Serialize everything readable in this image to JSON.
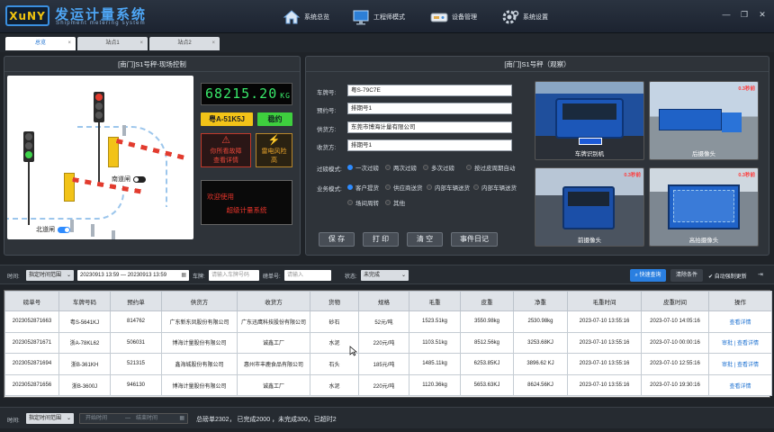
{
  "header": {
    "logo_text": "XuNY",
    "title": "发运计量系统",
    "subtitle": "Shipment metering system",
    "nav": [
      {
        "label": "系统总览",
        "icon": "home-icon"
      },
      {
        "label": "工程师模式",
        "icon": "monitor-icon"
      },
      {
        "label": "设备管理",
        "icon": "device-icon"
      },
      {
        "label": "系统设置",
        "icon": "gear-icon"
      }
    ],
    "window": {
      "minimize": "—",
      "restore": "❐",
      "close": "✕"
    }
  },
  "tabs": [
    {
      "label": "总览",
      "active": true
    },
    {
      "label": "站点1",
      "active": false
    },
    {
      "label": "站点2",
      "active": false
    }
  ],
  "left_panel": {
    "title": "[南门]S1号秤-现场控制",
    "south_gate": "南道闸",
    "north_gate": "北道闸",
    "weight": "68215.20",
    "unit": "KG",
    "plate": "粤A-51K5J",
    "status": "稳约",
    "alarm1": [
      "你所看故障",
      "查看详情"
    ],
    "alarm2": [
      "雷电风险",
      "高"
    ],
    "welcome": [
      "欢迎使用",
      "超级计量系统"
    ]
  },
  "right_panel": {
    "title": "[南门]S1号秤（观察）",
    "fields": [
      {
        "label": "车牌号:",
        "value": "粤S-79C7E"
      },
      {
        "label": "预约号:",
        "value": "排期号1"
      },
      {
        "label": "供货方:",
        "value": "东莞市博海计量有限公司"
      },
      {
        "label": "收货方:",
        "value": "排期号1"
      }
    ],
    "mode_label": "过磅模式:",
    "modes": [
      {
        "label": "一次过磅",
        "on": true
      },
      {
        "label": "两次过磅",
        "on": false
      },
      {
        "label": "多次过磅",
        "on": false
      },
      {
        "label": "按过皮周期自动",
        "on": false
      }
    ],
    "biz_label": "业务模式:",
    "biz": [
      {
        "label": "客户提货",
        "on": true
      },
      {
        "label": "供应商送货",
        "on": false
      },
      {
        "label": "内部车辆送货",
        "on": false
      },
      {
        "label": "内部车辆送货",
        "on": false
      },
      {
        "label": "场间周转",
        "on": false
      },
      {
        "label": "其他",
        "on": false
      }
    ],
    "buttons": [
      "保 存",
      "打 印",
      "清 空",
      "事件日记"
    ],
    "cameras": [
      {
        "caption": "车牌识别机",
        "tag": "",
        "bg": "#2a4f8f"
      },
      {
        "caption": "后摄像头",
        "tag": "0.3秒前",
        "bg": "#7fa3c7"
      },
      {
        "caption": "前摄像头",
        "tag": "0.3秒前",
        "bg": "#5b6a80"
      },
      {
        "caption": "高拍摄像头",
        "tag": "0.3秒前",
        "bg": "#6c7b8a"
      }
    ]
  },
  "filter": {
    "time_label": "时间:",
    "time_range": "指定时间范围",
    "time_value": "20230913  13:59 — 20230913  13:59",
    "plate_label": "车牌:",
    "plate_placeholder": "请输入车牌号码",
    "weigh_label": "磅单号:",
    "weigh_placeholder": "请输入",
    "state_label": "状态:",
    "state_value": "未完成",
    "quick": "快速查询",
    "clear": "清除条件",
    "auto": "自动强制更新"
  },
  "table": {
    "headers": [
      "磅单号",
      "车牌号码",
      "预约单",
      "供货方",
      "收货方",
      "货物",
      "规格",
      "毛重",
      "皮重",
      "净重",
      "毛重时间",
      "皮重时间",
      "操作"
    ],
    "rows": [
      [
        "2023052871663",
        "粤S-5641KJ",
        "814762",
        "广东新东凤股份有限公司",
        "广东迅鹰科技股份有限公司",
        "砂石",
        "52元/吨",
        "1523.51kg",
        "3550.98kg",
        "2530.98kg",
        "2023-07-10  13:55:16",
        "2023-07-10  14:05:16",
        "查看详情"
      ],
      [
        "2023052871671",
        "浙A-78KL62",
        "506031",
        "博海计量股份有限公司",
        "诚鑫工厂",
        "水泥",
        "220元/吨",
        "1103.51kg",
        "8512.56kg",
        "3253.68KJ",
        "2023-07-10  13:55:16",
        "2023-07-10  00:00:16",
        "审批 | 查看详情"
      ],
      [
        "2023052871694",
        "浙B-361KH",
        "521315",
        "鑫海城股份有限公司",
        "惠州市丰鹿食品有限公司",
        "石头",
        "185元/吨",
        "1485.11kg",
        "6253.85KJ",
        "3896.62 KJ",
        "2023-07-10  13:55:16",
        "2023-07-10  12:55:16",
        "审批 | 查看详情"
      ],
      [
        "2023052871656",
        "浙B-3600J",
        "946130",
        "博海计量股份有限公司",
        "诚鑫工厂",
        "水泥",
        "220元/吨",
        "1120.36kg",
        "5653.63KJ",
        "8624.56KJ",
        "2023-07-10  13:55:16",
        "2023-07-10  19:30:16",
        "查看详情"
      ]
    ]
  },
  "footer": {
    "time_label": "时间:",
    "time_range": "指定时间范围",
    "start": "开始时间",
    "end": "结束时间",
    "summary": "总磅单2302， 已完成2000 ，未完成300，已超时2"
  }
}
